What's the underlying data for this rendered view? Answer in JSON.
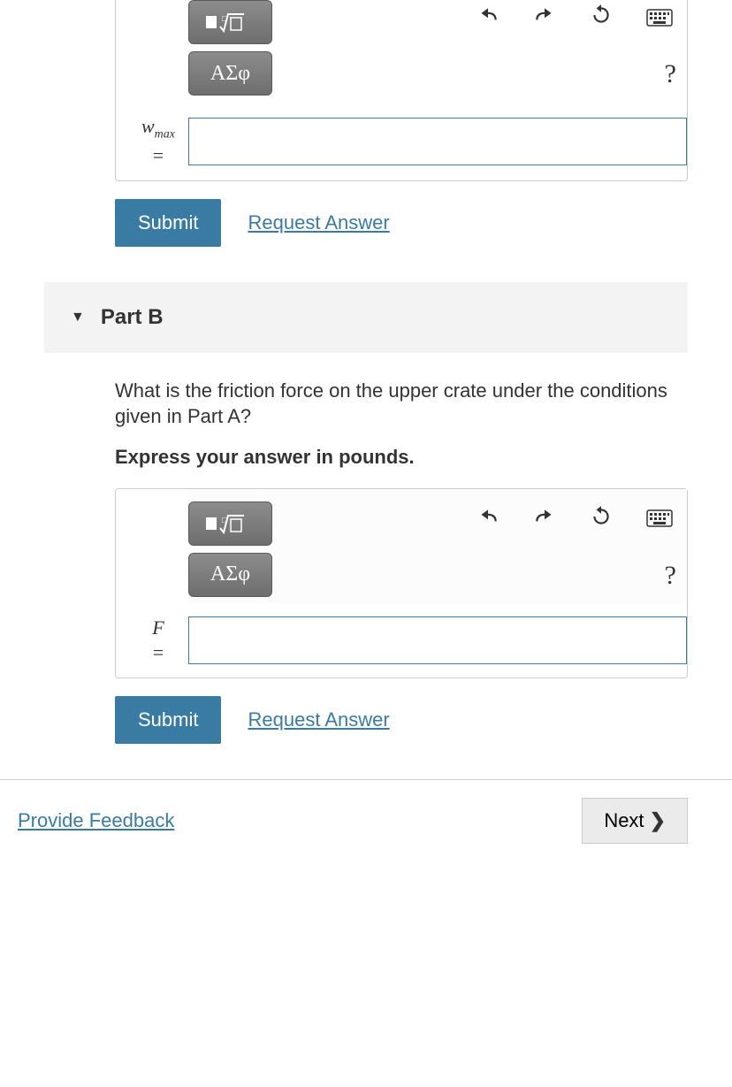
{
  "partA": {
    "greek_label": "ΑΣφ",
    "help": "?",
    "variable_html": "w",
    "variable_sub": "max",
    "equals": "=",
    "submit": "Submit",
    "request": "Request Answer"
  },
  "partB": {
    "header": "Part B",
    "question": "What is the friction force on the upper crate under the conditions given in Part A?",
    "instruction": "Express your answer in pounds.",
    "greek_label": "ΑΣφ",
    "help": "?",
    "variable": "F",
    "equals": "=",
    "submit": "Submit",
    "request": "Request Answer"
  },
  "footer": {
    "feedback": "Provide Feedback",
    "next": "Next"
  }
}
